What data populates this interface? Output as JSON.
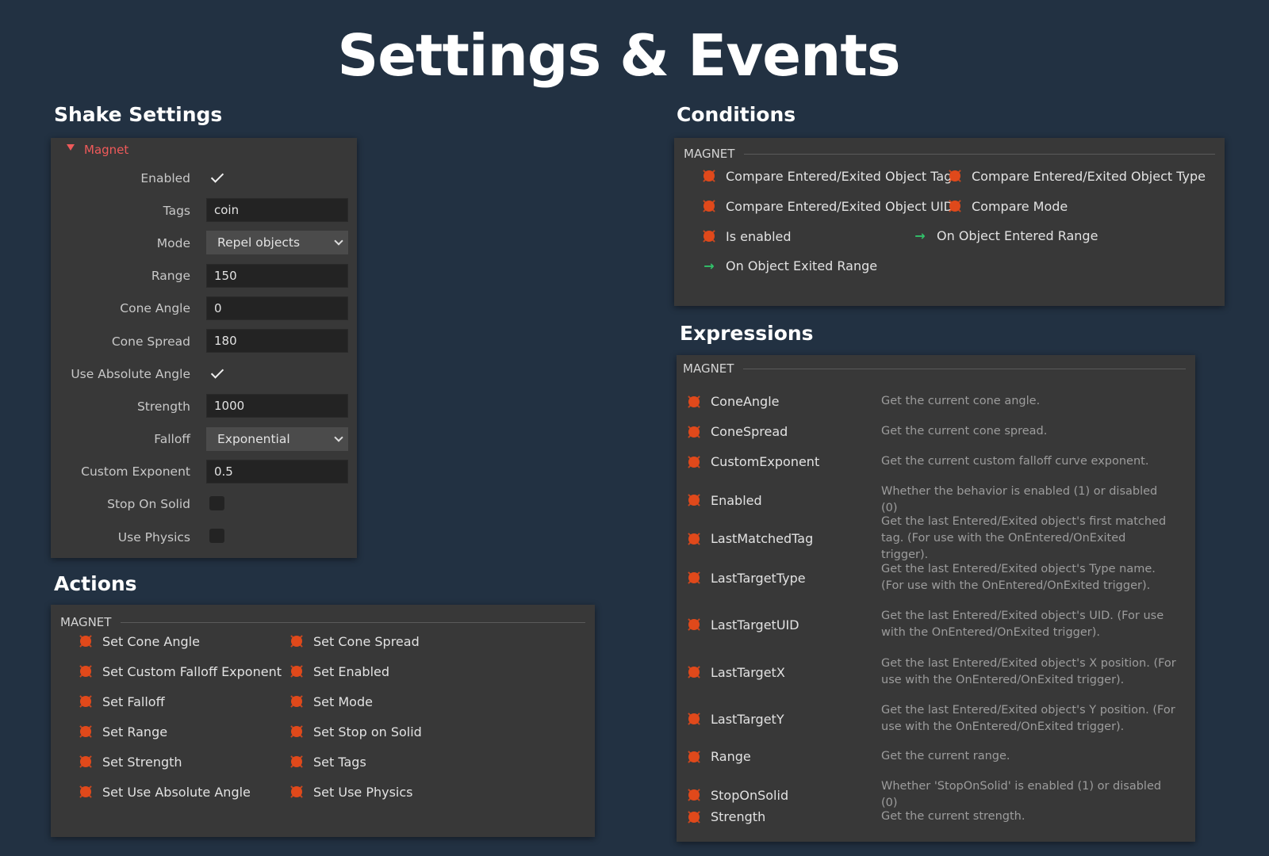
{
  "title": "Settings & Events",
  "shake_settings": {
    "heading": "Shake Settings",
    "section": "Magnet",
    "rows": [
      {
        "label": "Enabled",
        "type": "checkbox",
        "checked": true
      },
      {
        "label": "Tags",
        "type": "text",
        "value": "coin"
      },
      {
        "label": "Mode",
        "type": "select",
        "value": "Repel objects"
      },
      {
        "label": "Range",
        "type": "text",
        "value": "150"
      },
      {
        "label": "Cone Angle",
        "type": "text",
        "value": "0"
      },
      {
        "label": "Cone Spread",
        "type": "text",
        "value": "180"
      },
      {
        "label": "Use Absolute Angle",
        "type": "checkbox",
        "checked": true
      },
      {
        "label": "Strength",
        "type": "text",
        "value": "1000"
      },
      {
        "label": "Falloff",
        "type": "select",
        "value": "Exponential"
      },
      {
        "label": "Custom Exponent",
        "type": "text",
        "value": "0.5"
      },
      {
        "label": "Stop On Solid",
        "type": "checkbox",
        "checked": false
      },
      {
        "label": "Use Physics",
        "type": "checkbox",
        "checked": false
      }
    ]
  },
  "actions": {
    "heading": "Actions",
    "group": "MAGNET",
    "items": [
      "Set Cone Angle",
      "Set Cone Spread",
      "Set Custom Falloff Exponent",
      "Set Enabled",
      "Set Falloff",
      "Set Mode",
      "Set Range",
      "Set Stop on Solid",
      "Set Strength",
      "Set Tags",
      "Set Use Absolute Angle",
      "Set Use Physics"
    ]
  },
  "conditions": {
    "heading": "Conditions",
    "group": "MAGNET",
    "items": [
      {
        "label": "Compare Entered/Exited Object Tag",
        "icon": "bug-icon"
      },
      {
        "label": "Compare Entered/Exited Object Type",
        "icon": "bug-icon"
      },
      {
        "label": "Compare Entered/Exited Object UID",
        "icon": "bug-icon"
      },
      {
        "label": "Compare Mode",
        "icon": "bug-icon"
      },
      {
        "label": "Is enabled",
        "icon": "bug-icon"
      },
      {
        "label": "On Object Entered Range",
        "icon": "trigger-arrow-icon"
      },
      {
        "label": "On Object Exited Range",
        "icon": "trigger-arrow-icon"
      }
    ]
  },
  "expressions": {
    "heading": "Expressions",
    "group": "MAGNET",
    "items": [
      {
        "name": "ConeAngle",
        "desc": "Get the current cone angle."
      },
      {
        "name": "ConeSpread",
        "desc": "Get the current cone spread."
      },
      {
        "name": "CustomExponent",
        "desc": "Get the current custom falloff curve exponent."
      },
      {
        "name": "Enabled",
        "desc": "Whether the behavior is enabled (1) or disabled (0)"
      },
      {
        "name": "LastMatchedTag",
        "desc": "Get the last Entered/Exited object's first matched tag. (For use with the OnEntered/OnExited trigger)."
      },
      {
        "name": "LastTargetType",
        "desc": "Get the last Entered/Exited object's Type name. (For use with the OnEntered/OnExited trigger)."
      },
      {
        "name": "LastTargetUID",
        "desc": "Get the last Entered/Exited object's UID. (For use with the OnEntered/OnExited trigger)."
      },
      {
        "name": "LastTargetX",
        "desc": "Get the last Entered/Exited object's X position. (For use with the OnEntered/OnExited trigger)."
      },
      {
        "name": "LastTargetY",
        "desc": "Get the last Entered/Exited object's Y position. (For use with the OnEntered/OnExited trigger)."
      },
      {
        "name": "Range",
        "desc": "Get the current range."
      },
      {
        "name": "StopOnSolid",
        "desc": "Whether 'StopOnSolid' is enabled (1) or disabled (0)"
      },
      {
        "name": "Strength",
        "desc": "Get the current strength."
      }
    ]
  },
  "colors": {
    "background": "#223142",
    "panel": "#383838",
    "accent_red": "#ef5a5a",
    "icon_orange": "#e0491b",
    "trigger_green": "#31c26a"
  }
}
